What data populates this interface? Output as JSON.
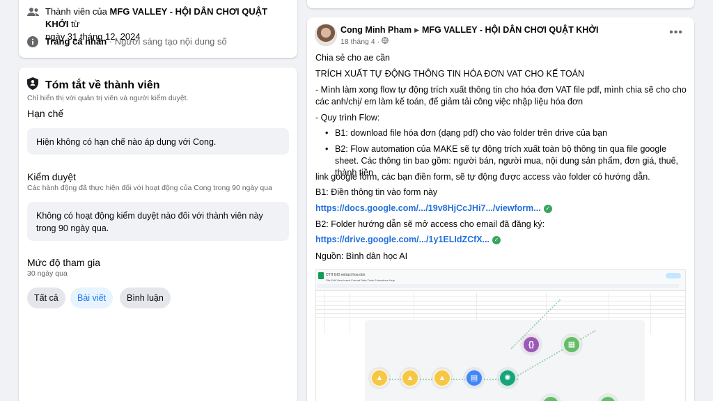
{
  "about": {
    "member_prefix": "Thành viên của ",
    "group_name": "MFG VALLEY - HỘI DÂN CHƠI QUẬT KHỞI",
    "member_suffix": " từ",
    "member_date": "ngày 31 tháng 12, 2024",
    "profile_label": "Trang cá nhân",
    "profile_sep": " · ",
    "profile_desc": "Người sáng tạo nội dung số"
  },
  "summary": {
    "title": "Tóm tắt về thành viên",
    "subtitle": "Chỉ hiển thị với quản trị viên và người kiểm duyệt.",
    "restriction_heading": "Hạn chế",
    "restriction_text": "Hiện không có hạn chế nào áp dụng với Cong.",
    "moderation_heading": "Kiểm duyệt",
    "moderation_sub": "Các hành động đã thực hiện đối với hoạt động của Cong trong 90 ngày qua",
    "moderation_text": "Không có hoạt động kiểm duyệt nào đối với thành viên này trong 90 ngày qua.",
    "engagement_heading": "Mức độ tham gia",
    "engagement_sub": "30 ngày qua",
    "filters": [
      "Tất cả",
      "Bài viết",
      "Bình luận"
    ],
    "active_filter": "Bài viết"
  },
  "post": {
    "author": "Cong Minh Pham",
    "group": "MFG VALLEY - HỘI DÂN CHƠI QUẬT KHỞI",
    "date": "18 tháng 4",
    "privacy_icon": "globe-icon",
    "lines": {
      "l1": "Chia sẻ cho ae cần",
      "l2": "TRÍCH XUẤT TỰ ĐỘNG THÔNG TIN HÓA ĐƠN VAT CHO KẾ TOÁN",
      "l3a": "- Mình làm xong flow tự động trích xuất thông tin cho hóa đơn VAT file pdf, mình chia sẽ cho cho",
      "l3b": "các anh/chị/ em làm kế toán, để giảm tải công việc nhập liệu hóa đơn",
      "l4": "- Quy trình Flow:",
      "b1": "B1: download file hóa đơn (dạng pdf) cho vào folder trên drive của bạn",
      "b2": "B2: Flow automation của MAKE sẽ tự động trích xuất toàn bộ thông tin qua file google sheet. Các thông tin bao gồm: người bán, người mua, nội dung sản phẩm, đơn giá, thuế, thành tiền",
      "l5": "link google form, các bạn điền form, sẽ tự động được access vào folder có hướng dẫn.",
      "l6": "B1: Điền thông tin vào form này",
      "link1": "https://docs.google.com/.../19v8HjCcJHi7.../viewform...",
      "l7": "B2: Folder hướng dẫn sẽ mở access cho email đã đăng ký:",
      "link2": "https://drive.google.com/.../1y1ELIdZCfX...",
      "l8": "Nguồn: Bình dân học AI"
    },
    "image_title": "CTH GID extract hoa don",
    "image_menu": "File  Edit  View  Insert  Format  Data  Tools  Extensions  Help"
  },
  "colors": {
    "accent": "#1877f2",
    "link": "#216fdb",
    "verified": "#3ba55d",
    "make_node": "#f6c744",
    "doc_node": "#4285f4",
    "openai_node": "#18a47b",
    "json_node": "#9b59b6"
  }
}
